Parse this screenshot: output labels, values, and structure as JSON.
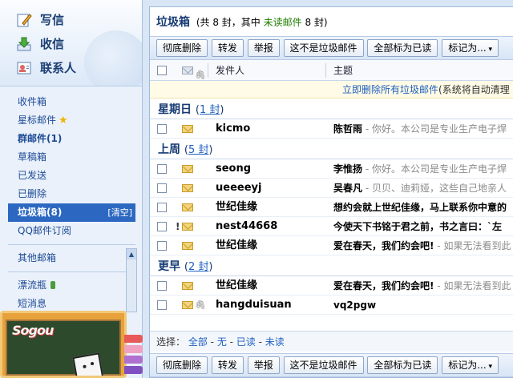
{
  "sidebar": {
    "compose": "写信",
    "inbox": "收信",
    "contacts": "联系人",
    "folders": {
      "inbox": "收件箱",
      "starred": "星标邮件",
      "group": "群邮件(1)",
      "drafts": "草稿箱",
      "sent": "已发送",
      "deleted": "已删除",
      "spam": "垃圾箱(8)",
      "spam_clear": "[清空]",
      "qq_subscription": "QQ邮件订阅",
      "other": "其他邮箱",
      "bottle": "漂流瓶",
      "sms": "短消息"
    },
    "sogou_logo": "Sogou"
  },
  "header": {
    "title": "垃圾箱",
    "count_prefix": "(共 8 封，其中",
    "count_unread": "未读邮件",
    "count_suffix": "8 封)"
  },
  "toolbar": {
    "delete_forever": "彻底删除",
    "forward": "转发",
    "report": "举报",
    "not_spam": "这不是垃圾邮件",
    "mark_all_read": "全部标为已读",
    "mark_as": "标记为..."
  },
  "columns": {
    "sender": "发件人",
    "subject": "主题"
  },
  "notice": {
    "link": "立即删除所有垃圾邮件",
    "note": "(系统将自动清理"
  },
  "groups": [
    {
      "label": "星期日",
      "count": "1 封",
      "rows": [
        {
          "sender": "kicmo",
          "title": "陈哲雨",
          "preview": " - 你好。本公司是专业生产电子焊",
          "flag": "",
          "attach": false
        }
      ]
    },
    {
      "label": "上周",
      "count": "5 封",
      "rows": [
        {
          "sender": "seong",
          "title": "李惟扬",
          "preview": " - 你好。本公司是专业生产电子焊",
          "flag": "",
          "attach": false
        },
        {
          "sender": "ueeeeyj",
          "title": "吴春凡",
          "preview": " - 贝贝、迪莉娅，这些自己地亲人",
          "flag": "",
          "attach": false
        },
        {
          "sender": "世纪佳缘",
          "title": "想约会就上世纪佳缘，马上联系你中意的",
          "preview": "",
          "flag": "",
          "attach": false
        },
        {
          "sender": "nest44668",
          "title": "今使天下书铭于君之前，书之言曰：`左",
          "preview": "",
          "flag": "!",
          "attach": false
        },
        {
          "sender": "世纪佳缘",
          "title": "爱在春天，我们约会吧!",
          "preview": " - 如果无法看到此",
          "flag": "",
          "attach": false
        }
      ]
    },
    {
      "label": "更早",
      "count": "2 封",
      "rows": [
        {
          "sender": "世纪佳缘",
          "title": "爱在春天，我们约会吧!",
          "preview": " - 如果无法看到此",
          "flag": "",
          "attach": false
        },
        {
          "sender": "hangduisuan",
          "title": "vq2pgw",
          "preview": "",
          "flag": "",
          "attach": true
        }
      ]
    }
  ],
  "select_bar": {
    "label": "选择：",
    "all": "全部",
    "none": "无",
    "read": "已读",
    "unread": "未读",
    "sep": " - "
  },
  "colors": {
    "accent": "#2c68c2",
    "title": "#153a72",
    "link": "#1f5fbf",
    "unread_green": "#1f7f00"
  }
}
